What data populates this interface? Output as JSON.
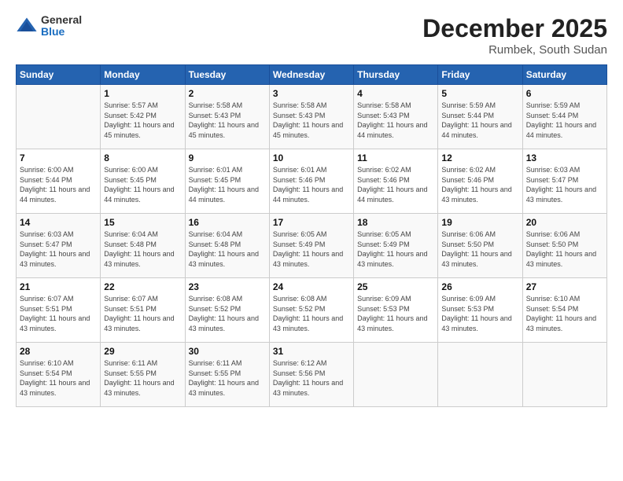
{
  "header": {
    "logo": {
      "general": "General",
      "blue": "Blue"
    },
    "title": "December 2025",
    "location": "Rumbek, South Sudan"
  },
  "calendar": {
    "days_of_week": [
      "Sunday",
      "Monday",
      "Tuesday",
      "Wednesday",
      "Thursday",
      "Friday",
      "Saturday"
    ],
    "weeks": [
      [
        {
          "day": "",
          "sunrise": "",
          "sunset": "",
          "daylight": ""
        },
        {
          "day": "1",
          "sunrise": "Sunrise: 5:57 AM",
          "sunset": "Sunset: 5:42 PM",
          "daylight": "Daylight: 11 hours and 45 minutes."
        },
        {
          "day": "2",
          "sunrise": "Sunrise: 5:58 AM",
          "sunset": "Sunset: 5:43 PM",
          "daylight": "Daylight: 11 hours and 45 minutes."
        },
        {
          "day": "3",
          "sunrise": "Sunrise: 5:58 AM",
          "sunset": "Sunset: 5:43 PM",
          "daylight": "Daylight: 11 hours and 45 minutes."
        },
        {
          "day": "4",
          "sunrise": "Sunrise: 5:58 AM",
          "sunset": "Sunset: 5:43 PM",
          "daylight": "Daylight: 11 hours and 44 minutes."
        },
        {
          "day": "5",
          "sunrise": "Sunrise: 5:59 AM",
          "sunset": "Sunset: 5:44 PM",
          "daylight": "Daylight: 11 hours and 44 minutes."
        },
        {
          "day": "6",
          "sunrise": "Sunrise: 5:59 AM",
          "sunset": "Sunset: 5:44 PM",
          "daylight": "Daylight: 11 hours and 44 minutes."
        }
      ],
      [
        {
          "day": "7",
          "sunrise": "Sunrise: 6:00 AM",
          "sunset": "Sunset: 5:44 PM",
          "daylight": "Daylight: 11 hours and 44 minutes."
        },
        {
          "day": "8",
          "sunrise": "Sunrise: 6:00 AM",
          "sunset": "Sunset: 5:45 PM",
          "daylight": "Daylight: 11 hours and 44 minutes."
        },
        {
          "day": "9",
          "sunrise": "Sunrise: 6:01 AM",
          "sunset": "Sunset: 5:45 PM",
          "daylight": "Daylight: 11 hours and 44 minutes."
        },
        {
          "day": "10",
          "sunrise": "Sunrise: 6:01 AM",
          "sunset": "Sunset: 5:46 PM",
          "daylight": "Daylight: 11 hours and 44 minutes."
        },
        {
          "day": "11",
          "sunrise": "Sunrise: 6:02 AM",
          "sunset": "Sunset: 5:46 PM",
          "daylight": "Daylight: 11 hours and 44 minutes."
        },
        {
          "day": "12",
          "sunrise": "Sunrise: 6:02 AM",
          "sunset": "Sunset: 5:46 PM",
          "daylight": "Daylight: 11 hours and 43 minutes."
        },
        {
          "day": "13",
          "sunrise": "Sunrise: 6:03 AM",
          "sunset": "Sunset: 5:47 PM",
          "daylight": "Daylight: 11 hours and 43 minutes."
        }
      ],
      [
        {
          "day": "14",
          "sunrise": "Sunrise: 6:03 AM",
          "sunset": "Sunset: 5:47 PM",
          "daylight": "Daylight: 11 hours and 43 minutes."
        },
        {
          "day": "15",
          "sunrise": "Sunrise: 6:04 AM",
          "sunset": "Sunset: 5:48 PM",
          "daylight": "Daylight: 11 hours and 43 minutes."
        },
        {
          "day": "16",
          "sunrise": "Sunrise: 6:04 AM",
          "sunset": "Sunset: 5:48 PM",
          "daylight": "Daylight: 11 hours and 43 minutes."
        },
        {
          "day": "17",
          "sunrise": "Sunrise: 6:05 AM",
          "sunset": "Sunset: 5:49 PM",
          "daylight": "Daylight: 11 hours and 43 minutes."
        },
        {
          "day": "18",
          "sunrise": "Sunrise: 6:05 AM",
          "sunset": "Sunset: 5:49 PM",
          "daylight": "Daylight: 11 hours and 43 minutes."
        },
        {
          "day": "19",
          "sunrise": "Sunrise: 6:06 AM",
          "sunset": "Sunset: 5:50 PM",
          "daylight": "Daylight: 11 hours and 43 minutes."
        },
        {
          "day": "20",
          "sunrise": "Sunrise: 6:06 AM",
          "sunset": "Sunset: 5:50 PM",
          "daylight": "Daylight: 11 hours and 43 minutes."
        }
      ],
      [
        {
          "day": "21",
          "sunrise": "Sunrise: 6:07 AM",
          "sunset": "Sunset: 5:51 PM",
          "daylight": "Daylight: 11 hours and 43 minutes."
        },
        {
          "day": "22",
          "sunrise": "Sunrise: 6:07 AM",
          "sunset": "Sunset: 5:51 PM",
          "daylight": "Daylight: 11 hours and 43 minutes."
        },
        {
          "day": "23",
          "sunrise": "Sunrise: 6:08 AM",
          "sunset": "Sunset: 5:52 PM",
          "daylight": "Daylight: 11 hours and 43 minutes."
        },
        {
          "day": "24",
          "sunrise": "Sunrise: 6:08 AM",
          "sunset": "Sunset: 5:52 PM",
          "daylight": "Daylight: 11 hours and 43 minutes."
        },
        {
          "day": "25",
          "sunrise": "Sunrise: 6:09 AM",
          "sunset": "Sunset: 5:53 PM",
          "daylight": "Daylight: 11 hours and 43 minutes."
        },
        {
          "day": "26",
          "sunrise": "Sunrise: 6:09 AM",
          "sunset": "Sunset: 5:53 PM",
          "daylight": "Daylight: 11 hours and 43 minutes."
        },
        {
          "day": "27",
          "sunrise": "Sunrise: 6:10 AM",
          "sunset": "Sunset: 5:54 PM",
          "daylight": "Daylight: 11 hours and 43 minutes."
        }
      ],
      [
        {
          "day": "28",
          "sunrise": "Sunrise: 6:10 AM",
          "sunset": "Sunset: 5:54 PM",
          "daylight": "Daylight: 11 hours and 43 minutes."
        },
        {
          "day": "29",
          "sunrise": "Sunrise: 6:11 AM",
          "sunset": "Sunset: 5:55 PM",
          "daylight": "Daylight: 11 hours and 43 minutes."
        },
        {
          "day": "30",
          "sunrise": "Sunrise: 6:11 AM",
          "sunset": "Sunset: 5:55 PM",
          "daylight": "Daylight: 11 hours and 43 minutes."
        },
        {
          "day": "31",
          "sunrise": "Sunrise: 6:12 AM",
          "sunset": "Sunset: 5:56 PM",
          "daylight": "Daylight: 11 hours and 43 minutes."
        },
        {
          "day": "",
          "sunrise": "",
          "sunset": "",
          "daylight": ""
        },
        {
          "day": "",
          "sunrise": "",
          "sunset": "",
          "daylight": ""
        },
        {
          "day": "",
          "sunrise": "",
          "sunset": "",
          "daylight": ""
        }
      ]
    ]
  }
}
